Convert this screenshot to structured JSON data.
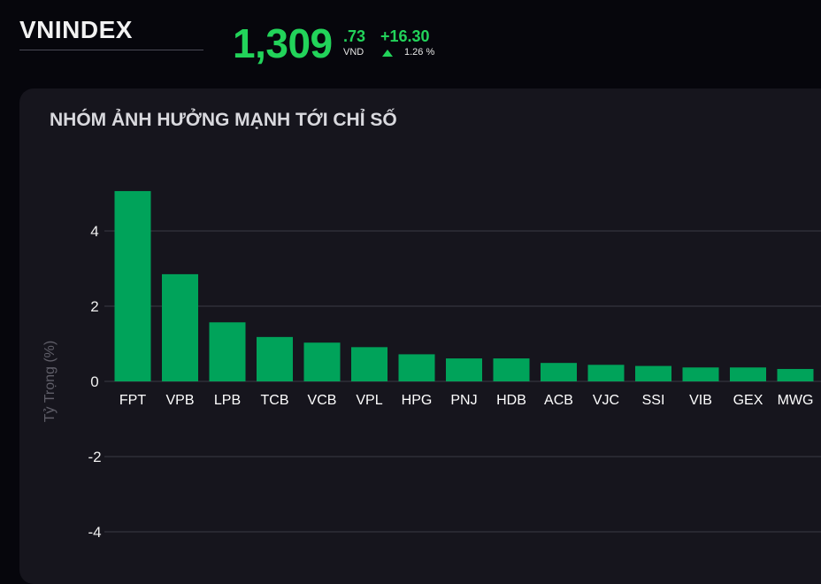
{
  "header": {
    "index_name": "VNINDEX",
    "price_main": "1,309",
    "price_decimal": ".73",
    "price_unit": "VND",
    "change_value": "+16.30",
    "change_direction": "up",
    "change_percent": "1.26 %"
  },
  "colors": {
    "positive": "#22d35a",
    "bar": "#00a35a",
    "background": "#06060c",
    "panel": "#16151d"
  },
  "panel": {
    "title": "NHÓM ẢNH HƯỞNG MẠNH TỚI CHỈ SỐ"
  },
  "chart_data": {
    "type": "bar",
    "title": "NHÓM ẢNH HƯỞNG MẠNH TỚI CHỈ SỐ",
    "ylabel": "Tỷ Trọng (%)",
    "xlabel": "",
    "categories": [
      "FPT",
      "VPB",
      "LPB",
      "TCB",
      "VCB",
      "VPL",
      "HPG",
      "PNJ",
      "HDB",
      "ACB",
      "VJC",
      "SSI",
      "VIB",
      "GEX",
      "MWG"
    ],
    "values": [
      5.06,
      2.85,
      1.57,
      1.18,
      1.03,
      0.91,
      0.72,
      0.61,
      0.61,
      0.49,
      0.44,
      0.41,
      0.37,
      0.37,
      0.33
    ],
    "ylim": [
      -5,
      6
    ],
    "yticks": [
      4,
      2,
      0,
      -2,
      -4
    ],
    "grid": true,
    "legend": "none"
  }
}
